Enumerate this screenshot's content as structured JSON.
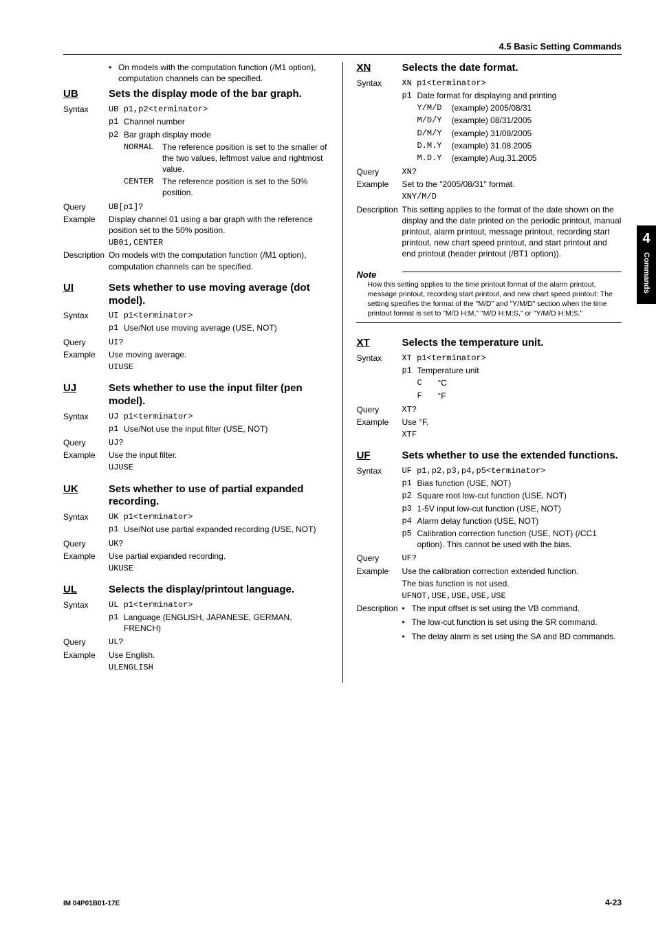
{
  "header": {
    "section_title": "4.5  Basic Setting Commands"
  },
  "tab": {
    "number": "4",
    "text": "Commands"
  },
  "footer": {
    "left": "IM 04P01B01-17E",
    "right": "4-23"
  },
  "intro_bullet": "On models with the computation function (/M1 option), computation channels can be specified.",
  "ub": {
    "code": "UB",
    "title": "Sets the display mode of the bar graph.",
    "syntax_label": "Syntax",
    "syntax": "UB p1,p2<terminator>",
    "p1_code": "p1",
    "p1_text": "Channel number",
    "p2_code": "p2",
    "p2_text": "Bar graph display mode",
    "opt1_code": "NORMAL",
    "opt1_text": "The reference position is set to the smaller of the two values, leftmost value and rightmost value.",
    "opt2_code": "CENTER",
    "opt2_text": "The reference position is set to the 50% position.",
    "query_label": "Query",
    "query_text": "UB[p1]?",
    "example_label": "Example",
    "example_text": "Display channel 01 using a bar graph with the reference position set to the 50% position.",
    "example_code": "UB01,CENTER",
    "desc_label": "Description",
    "desc_text": "On models with the computation function (/M1 option), computation channels can be specified."
  },
  "ui": {
    "code": "UI",
    "title": "Sets whether to use moving average (dot model).",
    "syntax_label": "Syntax",
    "syntax": "UI p1<terminator>",
    "p1_code": "p1",
    "p1_text": "Use/Not use moving average (USE, NOT)",
    "query_label": "Query",
    "query_text": "UI?",
    "example_label": "Example",
    "example_text": "Use moving average.",
    "example_code": "UIUSE"
  },
  "uj": {
    "code": "UJ",
    "title": "Sets whether to use the input filter (pen model).",
    "syntax_label": "Syntax",
    "syntax": "UJ p1<terminator>",
    "p1_code": "p1",
    "p1_text": "Use/Not use the input filter (USE, NOT)",
    "query_label": "Query",
    "query_text": "UJ?",
    "example_label": "Example",
    "example_text": "Use the input filter.",
    "example_code": "UJUSE"
  },
  "uk": {
    "code": "UK",
    "title": "Sets whether to use of partial expanded recording.",
    "syntax_label": "Syntax",
    "syntax": "UK p1<terminator>",
    "p1_code": "p1",
    "p1_text": "Use/Not use partial expanded recording (USE, NOT)",
    "query_label": "Query",
    "query_text": "UK?",
    "example_label": "Example",
    "example_text": "Use partial expanded recording.",
    "example_code": "UKUSE"
  },
  "ul": {
    "code": "UL",
    "title": "Selects the display/printout language.",
    "syntax_label": "Syntax",
    "syntax": "UL p1<terminator>",
    "p1_code": "p1",
    "p1_text": "Language (ENGLISH, JAPANESE, GERMAN, FRENCH)",
    "query_label": "Query",
    "query_text": "UL?",
    "example_label": "Example",
    "example_text": "Use English.",
    "example_code": "ULENGLISH"
  },
  "xn": {
    "code": "XN",
    "title": "Selects the date format.",
    "syntax_label": "Syntax",
    "syntax": "XN p1<terminator>",
    "p1_code": "p1",
    "p1_text": "Date format for displaying and printing",
    "o1c": "Y/M/D",
    "o1t": "(example) 2005/08/31",
    "o2c": "M/D/Y",
    "o2t": "(example) 08/31/2005",
    "o3c": "D/M/Y",
    "o3t": "(example) 31/08/2005",
    "o4c": "D.M.Y",
    "o4t": "(example) 31.08.2005",
    "o5c": "M.D.Y",
    "o5t": "(example) Aug.31.2005",
    "query_label": "Query",
    "query_text": "XN?",
    "example_label": "Example",
    "example_text": "Set to the \"2005/08/31\" format.",
    "example_code": "XNY/M/D",
    "desc_label": "Description",
    "desc_text": "This setting applies to the format of the date shown on the display and the date printed on the periodic printout, manual printout, alarm printout, message printout, recording start printout, new chart speed printout, and start printout and end printout (header printout (/BT1 option))."
  },
  "note": {
    "title": "Note",
    "body": "How this setting applies to the time printout format of the alarm printout, message printout, recording start printout, and new chart speed printout: The setting specifies the format of the \"M/D\" and \"Y/M/D\" section when the time printout format is set to \"M/D H:M,\" \"M/D H:M:S,\" or \"Y/M/D H:M:S.\""
  },
  "xt": {
    "code": "XT",
    "title": "Selects the temperature unit.",
    "syntax_label": "Syntax",
    "syntax": "XT p1<terminator>",
    "p1_code": "p1",
    "p1_text": "Temperature unit",
    "o1c": "C",
    "o1t": "°C",
    "o2c": "F",
    "o2t": "°F",
    "query_label": "Query",
    "query_text": "XT?",
    "example_label": "Example",
    "example_text": "Use °F.",
    "example_code": "XTF"
  },
  "uf": {
    "code": "UF",
    "title": "Sets whether to use the extended functions.",
    "syntax_label": "Syntax",
    "syntax": "UF p1,p2,p3,p4,p5<terminator>",
    "p1c": "p1",
    "p1t": "Bias function (USE, NOT)",
    "p2c": "p2",
    "p2t": "Square root low-cut function (USE, NOT)",
    "p3c": "p3",
    "p3t": "1-5V input low-cut function (USE, NOT)",
    "p4c": "p4",
    "p4t": "Alarm delay function (USE, NOT)",
    "p5c": "p5",
    "p5t": "Calibration correction function (USE, NOT) (/CC1 option). This cannot be used with the bias.",
    "query_label": "Query",
    "query_text": "UF?",
    "example_label": "Example",
    "example_text1": "Use the calibration correction extended function.",
    "example_text2": "The bias function is not used.",
    "example_code": "UFNOT,USE,USE,USE,USE",
    "desc_label": "Description",
    "d1": "The input offset is set using the VB command.",
    "d2": "The low-cut function is set using the SR command.",
    "d3": "The delay alarm is set using the SA and BD commands."
  }
}
